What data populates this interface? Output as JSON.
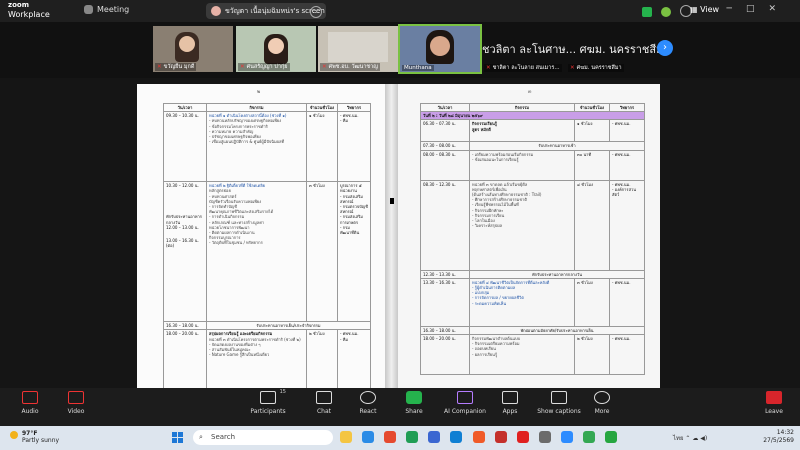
{
  "app": {
    "logo_line1": "zoom",
    "logo_line2": "Workplace",
    "meeting_label": "Meeting",
    "share_owner": "ขวัญตา เนื้อนุ่มฉิมหน่ร's screen",
    "view_label": "View"
  },
  "gallery": {
    "participants": [
      {
        "name": "ขวัญยืน มุกดี"
      },
      {
        "name": "ศนสรัญญา บ่ากุ่ย"
      },
      {
        "name": "ศพช.อบ. วัฒนาชาญ"
      },
      {
        "name": "Munthana"
      }
    ],
    "featured_name_top": "ชวลิตา ละโนศาษ... ศฆม. นครราชสีมา",
    "featured_name_bottom_1": "ชาลิตา ละโนลาย สนเมาร...",
    "featured_name_bottom_2": "ศฆม. นครราชสีมา"
  },
  "document": {
    "left_page_number": "๒",
    "right_page_number": "๓",
    "headers": [
      "วัน/เวลา",
      "กิจกรรม",
      "จำนวนชั่วโมง",
      "วิทยากร"
    ],
    "left_rows": [
      {
        "time": "09.30 – 10.30 น.",
        "activity": "หน่วยที่ ๑ ดำเนินโคงต่างสถานิ์ต้อง (ช่วงที่ ๑)",
        "detail": "- ทบทวนหลักปรัชญาของเศรษฐกิจพอเพียง\n- ข้อกิจกรรมโครงการพระราชดำริ\n- ความหมาย ความสำคัญ\n- ปรัชญาของเศรษฐกิจพอเพียง\n- เชื่อมสู่แผนปฏิบัติการ & ศูนย์ผู้มีปัจฉิมผลที่",
        "hours": "๑ ชั่วโมง",
        "speaker": "- ศพช.นม.\n- ทีม"
      },
      {
        "time": "10.30 – 12.00 น.",
        "activity": "หน่วยที่ ๒ ฐิติเดี่ยวที่ดี ใช้ลดเดยิย",
        "detail": "หลักสูตรย่อย\n- ทบทวนศาสตร์\nบัญชีครัวเรือนรับความพอเพียง\n- การจัดทำบัญชี\nพัฒนาคุณภาพชีวิตและส่งเสริมรายได้\n- การดำเนินกิจกรรม\n- หลักเกณฑ์ และทางสร้างมูลค่า\nหน่วยโภชนาการพัฒนา\n- ติดตามผลการดำเนินงาน\nกิจกรรมบูรณาการ\n- วัตถุดิบที่ในชุมชน / ทรัพยากร",
        "hours": "๓ ชั่วโมง",
        "speaker": "บูรณาการ ๕\nหน่วยงาน\n- กรมส่งเสริมสหกรณ์\n- กรมตรวจบัญชีสหกรณ์\n- กรมส่งเสริมการเกษตร\n- กรมพัฒนาที่ดิน"
      },
      {
        "time": "พักรับประทานอาหารกลางวัน\n12.00 – 13.00 น.",
        "activity": "",
        "detail": "",
        "hours": "",
        "speaker": ""
      },
      {
        "time": "13.00 – 16.30 น.\n(ต่อ)",
        "activity": "",
        "detail": "",
        "hours": "",
        "speaker": ""
      },
      {
        "time": "16.30 – 18.00 น.",
        "activity": "รับประทานอาหารเย็น/ประจำกิจกรรม",
        "detail": "",
        "hours": "",
        "speaker": ""
      },
      {
        "time": "18.00 – 20.00 น.",
        "activity": "สรุปผลการเรียนรู้ และเตรียมกิจกรรม",
        "detail": "หน่วยที่ ๓ ดำเนินโครงการตามพระราชดำริ (ช่วงที่ ๒)\n- จัดแสดงผลงานของทีมต่าง ๆ\n- สานสัมพันธ์ในหมู่คณะ\n- Nature Game รู้สึกเป็นหนึ่งเดียว",
        "hours": "๒ ชั่วโมง",
        "speaker": "- ศพช.นม.\n- ทีม"
      }
    ],
    "right_day_label": "วันที่ ๒ : วันที่ ๒๘ มิถุนายน ๒๕๖๙",
    "right_rows": [
      {
        "time": "06.30 – 07.30 น.",
        "activity": "กิจกรรมเรียนรู้\nสูตร หมักดี",
        "hours": "๑ ชั่วโมง",
        "speaker": "- ศพช.นม."
      },
      {
        "time": "07.30 – 08.00 น.",
        "activity": "รับประทานอาหารเช้า",
        "hours": "",
        "speaker": ""
      },
      {
        "time": "08.00 – 08.30 น.",
        "activity": "- เตรียมความพร้อมก่อนเริ่มกิจกรรม\n- ข้อเสนอแนะในการเรียนรู้",
        "hours": "๓๐ นาที",
        "speaker": "- ศพช.นม."
      },
      {
        "time": "08.30 – 12.30 น.",
        "activity": "หน่วยที่ ๓ ขาดลด แล้วเริ่มขยุ้ดีล\nพฤกษศาสตร์เพื่อเงิน\n(ต้นสร้างเส้นทางศึกษาธรรมชาติ : Trail)\n- ศึกษาการสร้างศึกษาธรรมชาติ\n- เรียนรู้พืชพรรณไม้ในพื้นที่\n- กิจกรรมฝึกทักษะ\n- กิจกรรมการเรียน\n- โลกในเมือง\n- วิเคราะห์สรุปผล",
        "hours": "๔ ชั่วโมง",
        "speaker": "- ศพช.นม.\n- องค์การสวนสัตว์"
      },
      {
        "time": "12.30 – 13.30 น.",
        "activity": "พักรับประทานอาหารกลางวัน",
        "hours": "",
        "speaker": ""
      },
      {
        "time": "13.30 – 16.30 น.",
        "activity": "หน่วยที่ ๔ พัฒนาชีวิตเป็นจัดการที่ดีและหลังดี\n- รู้ผู้ดำเนินการติดตามผล\n- แบ่งกลุ่ม\n- การจัดการผล / ขยายผลชีวิต\n- ระดมความคิดเห็น",
        "hours": "๓ ชั่วโมง",
        "speaker": "- ศพช.นม."
      },
      {
        "time": "16.30 – 18.00 น.",
        "activity": "พักผ่อนตามอัธยาศัย/รับประทานอาหารเย็น",
        "hours": "",
        "speaker": ""
      },
      {
        "time": "18.00 – 20.00 น.",
        "activity": "กิจกรรมพัฒนาตำบลต้นแบบ\n- กิจกรรมเตรียมความพร้อม\n- ถอดบทเรียน\n- ผลการเรียนรู้",
        "hours": "๒ ชั่วโมง",
        "speaker": "- ศพช.นม."
      }
    ]
  },
  "toolbar": {
    "audio": "Audio",
    "video": "Video",
    "participants": "Participants",
    "participants_count": "15",
    "chat": "Chat",
    "react": "React",
    "share": "Share",
    "ai_companion": "AI Companion",
    "apps": "Apps",
    "show_captions": "Show captions",
    "more": "More",
    "leave": "Leave"
  },
  "taskbar": {
    "temperature": "97°F",
    "weather": "Partly sunny",
    "search_placeholder": "Search",
    "time": "14:32",
    "date": "27/5/2569"
  },
  "colors": {
    "accent": "#2d8cff",
    "share_green": "#25b34d",
    "leave_red": "#d7252b",
    "day_header_purple": "#c99ee8",
    "active_speaker": "#7ac142"
  }
}
